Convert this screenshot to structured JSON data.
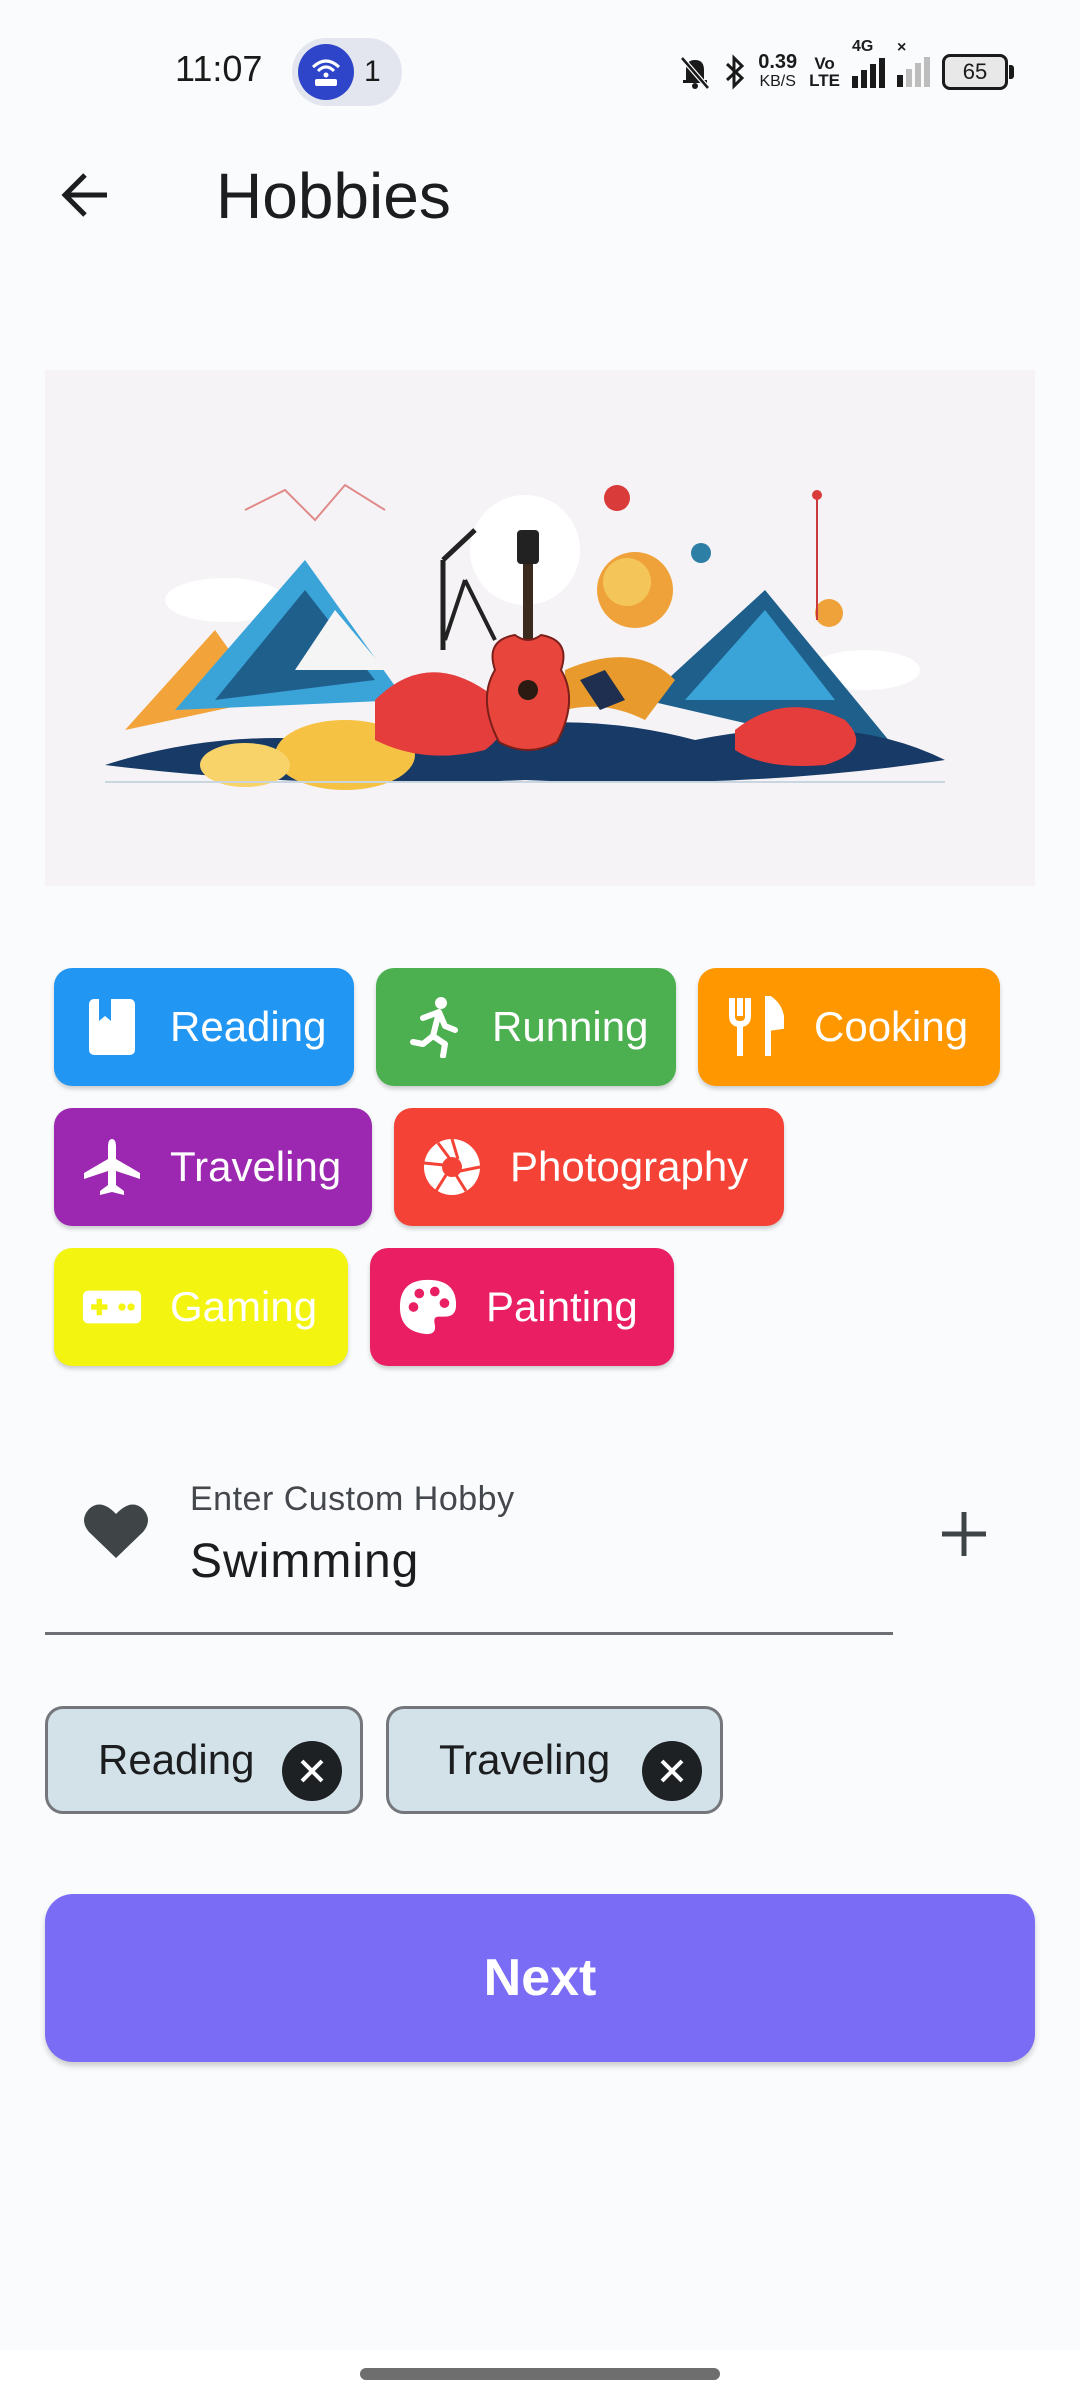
{
  "status_bar": {
    "time": "11:07",
    "hotspot_count": "1",
    "net_speed_value": "0.39",
    "net_speed_unit": "KB/S",
    "volte_top": "Vo",
    "volte_bottom": "LTE",
    "network_type": "4G",
    "battery": "65"
  },
  "app_bar": {
    "title": "Hobbies"
  },
  "hobbies": [
    {
      "label": "Reading",
      "icon": "book-icon",
      "color": "#2196f3"
    },
    {
      "label": "Running",
      "icon": "running-icon",
      "color": "#4caf50"
    },
    {
      "label": "Cooking",
      "icon": "restaurant-icon",
      "color": "#ff9800"
    },
    {
      "label": "Traveling",
      "icon": "airplane-icon",
      "color": "#9c27b0"
    },
    {
      "label": "Photography",
      "icon": "camera-aperture-icon",
      "color": "#f44336"
    },
    {
      "label": "Gaming",
      "icon": "gamepad-icon",
      "color": "#f4f411"
    },
    {
      "label": "Painting",
      "icon": "palette-icon",
      "color": "#e91e63"
    }
  ],
  "custom_hobby": {
    "label": "Enter Custom Hobby",
    "value": "Swimming",
    "icon": "heart-icon",
    "add_icon": "plus-icon"
  },
  "selected": [
    {
      "label": "Reading",
      "remove_icon": "close-icon"
    },
    {
      "label": "Traveling",
      "remove_icon": "close-icon"
    }
  ],
  "actions": {
    "next_label": "Next",
    "next_color": "#7b6cf6"
  }
}
